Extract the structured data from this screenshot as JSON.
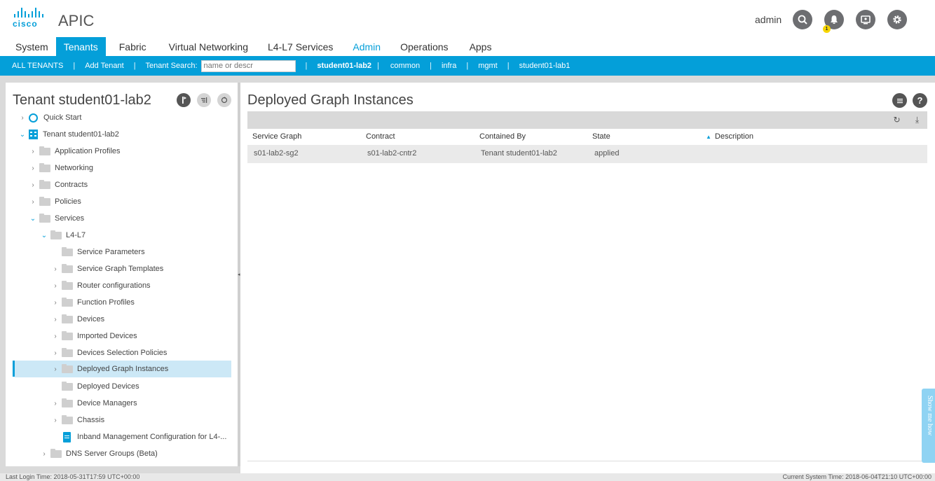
{
  "header": {
    "logo_text": "cisco",
    "app_name": "APIC",
    "user": "admin",
    "notification_count": "1",
    "icons": [
      "search-icon",
      "bell-icon",
      "screen-icon",
      "gear-icon"
    ]
  },
  "menu": {
    "items": [
      "System",
      "Tenants",
      "Fabric",
      "Virtual Networking",
      "L4-L7 Services",
      "Admin",
      "Operations",
      "Apps"
    ],
    "active": "Tenants",
    "highlighted": "Admin"
  },
  "tenant_bar": {
    "all_tenants": "ALL TENANTS",
    "add_tenant": "Add Tenant",
    "search_label": "Tenant Search:",
    "search_placeholder": "name or descr",
    "tenants": [
      "student01-lab2",
      "common",
      "infra",
      "mgmt",
      "student01-lab1"
    ]
  },
  "left_panel": {
    "title": "Tenant student01-lab2",
    "tree": [
      {
        "label": "Quick Start"
      },
      {
        "label": "Tenant student01-lab2"
      },
      {
        "label": "Application Profiles"
      },
      {
        "label": "Networking"
      },
      {
        "label": "Contracts"
      },
      {
        "label": "Policies"
      },
      {
        "label": "Services"
      },
      {
        "label": "L4-L7"
      },
      {
        "label": "Service Parameters"
      },
      {
        "label": "Service Graph Templates"
      },
      {
        "label": "Router configurations"
      },
      {
        "label": "Function Profiles"
      },
      {
        "label": "Devices"
      },
      {
        "label": "Imported Devices"
      },
      {
        "label": "Devices Selection Policies"
      },
      {
        "label": "Deployed Graph Instances"
      },
      {
        "label": "Deployed Devices"
      },
      {
        "label": "Device Managers"
      },
      {
        "label": "Chassis"
      },
      {
        "label": "Inband Management Configuration for L4-..."
      },
      {
        "label": "DNS Server Groups (Beta)"
      }
    ],
    "selected": "Deployed Graph Instances"
  },
  "main": {
    "title": "Deployed Graph Instances",
    "table": {
      "columns": [
        "Service Graph",
        "Contract",
        "Contained By",
        "State",
        "Description"
      ],
      "rows": [
        [
          "s01-lab2-sg2",
          "s01-lab2-cntr2",
          "Tenant student01-lab2",
          "applied",
          ""
        ]
      ]
    }
  },
  "show_me_how": "Show me how",
  "footer": {
    "last_login": "Last Login Time: 2018-05-31T17:59 UTC+00:00",
    "system_time": "Current System Time: 2018-06-04T21:10 UTC+00:00"
  },
  "colors": {
    "accent": "#049fd9",
    "selected_row": "#cce8f6",
    "badge": "#f7d600"
  }
}
